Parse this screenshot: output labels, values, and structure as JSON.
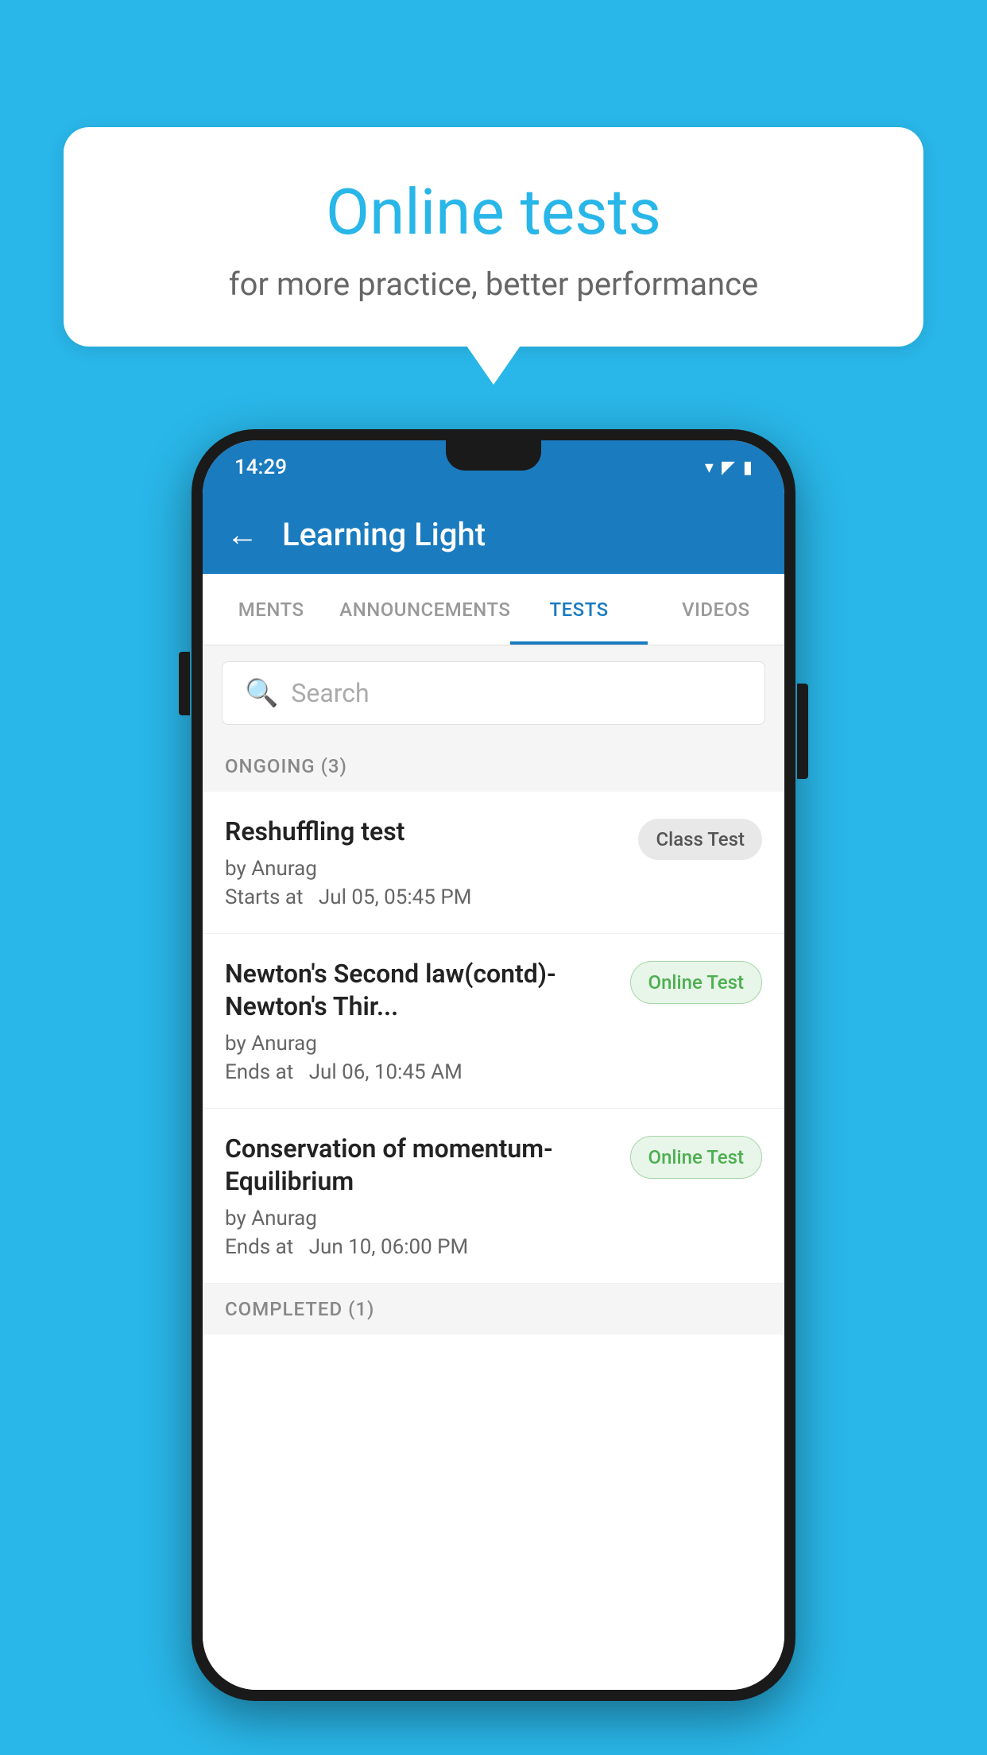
{
  "background_color": "#29b6e8",
  "bubble": {
    "title": "Online tests",
    "subtitle": "for more practice, better performance"
  },
  "phone": {
    "status_bar": {
      "time": "14:29",
      "icons": [
        "wifi",
        "signal",
        "battery"
      ]
    },
    "app_bar": {
      "back_label": "←",
      "title": "Learning Light"
    },
    "tabs": [
      {
        "label": "MENTS",
        "active": false
      },
      {
        "label": "ANNOUNCEMENTS",
        "active": false
      },
      {
        "label": "TESTS",
        "active": true
      },
      {
        "label": "VIDEOS",
        "active": false
      }
    ],
    "search": {
      "placeholder": "Search"
    },
    "section_ongoing": {
      "title": "ONGOING (3)"
    },
    "tests": [
      {
        "name": "Reshuffling test",
        "author": "by Anurag",
        "time_label": "Starts at",
        "time": "Jul 05, 05:45 PM",
        "badge": "Class Test",
        "badge_type": "class"
      },
      {
        "name": "Newton's Second law(contd)-Newton's Thir...",
        "author": "by Anurag",
        "time_label": "Ends at",
        "time": "Jul 06, 10:45 AM",
        "badge": "Online Test",
        "badge_type": "online"
      },
      {
        "name": "Conservation of momentum-Equilibrium",
        "author": "by Anurag",
        "time_label": "Ends at",
        "time": "Jun 10, 06:00 PM",
        "badge": "Online Test",
        "badge_type": "online"
      }
    ],
    "section_completed": {
      "title": "COMPLETED (1)"
    }
  }
}
